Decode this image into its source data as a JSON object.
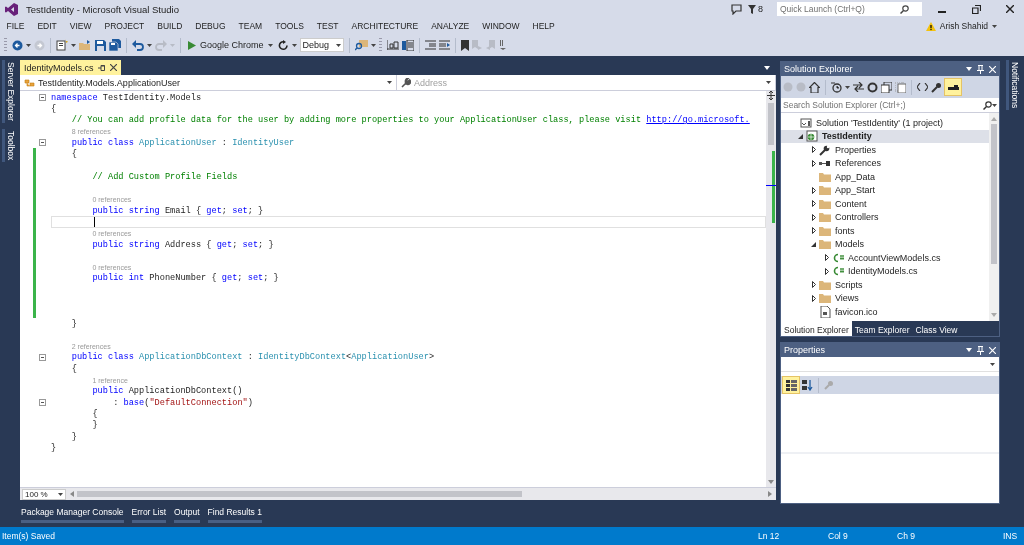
{
  "window": {
    "title": "TestIdentity - Microsoft Visual Studio",
    "notification_count": "8",
    "quick_launch": {
      "placeholder": "Quick Launch (Ctrl+Q)"
    }
  },
  "menu": [
    "FILE",
    "EDIT",
    "VIEW",
    "PROJECT",
    "BUILD",
    "DEBUG",
    "TEAM",
    "TOOLS",
    "TEST",
    "ARCHITECTURE",
    "ANALYZE",
    "WINDOW",
    "HELP"
  ],
  "account": {
    "name": "Arish Shahid"
  },
  "toolbar": {
    "start_target": "Google Chrome",
    "configuration": "Debug"
  },
  "left_side_tabs": [
    "Server Explorer",
    "Toolbox"
  ],
  "right_side_tabs": [
    "Notifications"
  ],
  "editor": {
    "tabs": [
      {
        "label": "IdentityModels.cs",
        "selected": true
      }
    ],
    "type_dropdown": "TestIdentity.Models.ApplicationUser",
    "member_dropdown": "Address",
    "lines": [
      {
        "collapsible": true,
        "changed": false,
        "current": false,
        "tokens": [
          {
            "kind": "keyword",
            "text": "namespace"
          },
          {
            "kind": "plain",
            "text": " TestIdentity.Models"
          }
        ]
      },
      {
        "collapsible": false,
        "changed": false,
        "current": false,
        "tokens": [
          {
            "kind": "plain",
            "text": "{"
          }
        ]
      },
      {
        "collapsible": false,
        "changed": false,
        "current": false,
        "tokens": [
          {
            "kind": "comment",
            "text": "    // You can add profile data for the user by adding more properties to your ApplicationUser class, please visit "
          },
          {
            "kind": "link",
            "text": "http://go.microsoft."
          }
        ]
      },
      {
        "collapsible": false,
        "changed": false,
        "current": false,
        "tokens": [
          {
            "kind": "codelens",
            "text": "    8 references"
          }
        ]
      },
      {
        "collapsible": true,
        "changed": false,
        "current": false,
        "tokens": [
          {
            "kind": "keyword",
            "text": "    public class "
          },
          {
            "kind": "type",
            "text": "ApplicationUser"
          },
          {
            "kind": "plain",
            "text": " : "
          },
          {
            "kind": "type",
            "text": "IdentityUser"
          }
        ]
      },
      {
        "collapsible": false,
        "changed": true,
        "current": false,
        "tokens": [
          {
            "kind": "plain",
            "text": "    {"
          }
        ]
      },
      {
        "collapsible": false,
        "changed": true,
        "current": false
      },
      {
        "collapsible": false,
        "changed": true,
        "current": false,
        "tokens": [
          {
            "kind": "comment",
            "text": "        // Add Custom Profile Fields"
          }
        ]
      },
      {
        "collapsible": false,
        "changed": true,
        "current": false
      },
      {
        "collapsible": false,
        "changed": true,
        "current": false,
        "tokens": [
          {
            "kind": "codelens",
            "text": "        0 references"
          }
        ]
      },
      {
        "collapsible": false,
        "changed": true,
        "current": false,
        "tokens": [
          {
            "kind": "keyword",
            "text": "        public string"
          },
          {
            "kind": "plain",
            "text": " Email { "
          },
          {
            "kind": "keyword",
            "text": "get"
          },
          {
            "kind": "plain",
            "text": "; "
          },
          {
            "kind": "keyword",
            "text": "set"
          },
          {
            "kind": "plain",
            "text": "; }"
          }
        ]
      },
      {
        "collapsible": false,
        "changed": true,
        "current": true
      },
      {
        "collapsible": false,
        "changed": true,
        "current": false,
        "tokens": [
          {
            "kind": "codelens",
            "text": "        0 references"
          }
        ]
      },
      {
        "collapsible": false,
        "changed": true,
        "current": false,
        "tokens": [
          {
            "kind": "keyword",
            "text": "        public string"
          },
          {
            "kind": "plain",
            "text": " Address { "
          },
          {
            "kind": "keyword",
            "text": "get"
          },
          {
            "kind": "plain",
            "text": "; "
          },
          {
            "kind": "keyword",
            "text": "set"
          },
          {
            "kind": "plain",
            "text": "; }"
          }
        ]
      },
      {
        "collapsible": false,
        "changed": true,
        "current": false
      },
      {
        "collapsible": false,
        "changed": true,
        "current": false,
        "tokens": [
          {
            "kind": "codelens",
            "text": "        0 references"
          }
        ]
      },
      {
        "collapsible": false,
        "changed": true,
        "current": false,
        "tokens": [
          {
            "kind": "keyword",
            "text": "        public int"
          },
          {
            "kind": "plain",
            "text": " PhoneNumber { "
          },
          {
            "kind": "keyword",
            "text": "get"
          },
          {
            "kind": "plain",
            "text": "; "
          },
          {
            "kind": "keyword",
            "text": "set"
          },
          {
            "kind": "plain",
            "text": "; }"
          }
        ]
      },
      {
        "collapsible": false,
        "changed": true,
        "current": false
      },
      {
        "collapsible": false,
        "changed": true,
        "current": false
      },
      {
        "collapsible": false,
        "changed": true,
        "current": false
      },
      {
        "collapsible": false,
        "changed": false,
        "current": false,
        "tokens": [
          {
            "kind": "plain",
            "text": "    }"
          }
        ]
      },
      {
        "collapsible": false,
        "changed": false,
        "current": false
      },
      {
        "collapsible": false,
        "changed": false,
        "current": false,
        "tokens": [
          {
            "kind": "codelens",
            "text": "    2 references"
          }
        ]
      },
      {
        "collapsible": true,
        "changed": false,
        "current": false,
        "tokens": [
          {
            "kind": "keyword",
            "text": "    public class "
          },
          {
            "kind": "type",
            "text": "ApplicationDbContext"
          },
          {
            "kind": "plain",
            "text": " : "
          },
          {
            "kind": "type",
            "text": "IdentityDbContext"
          },
          {
            "kind": "plain",
            "text": "<"
          },
          {
            "kind": "type",
            "text": "ApplicationUser"
          },
          {
            "kind": "plain",
            "text": ">"
          }
        ]
      },
      {
        "collapsible": false,
        "changed": false,
        "current": false,
        "tokens": [
          {
            "kind": "plain",
            "text": "    {"
          }
        ]
      },
      {
        "collapsible": false,
        "changed": false,
        "current": false,
        "tokens": [
          {
            "kind": "codelens",
            "text": "        1 reference"
          }
        ]
      },
      {
        "collapsible": false,
        "changed": false,
        "current": false,
        "tokens": [
          {
            "kind": "keyword",
            "text": "        public"
          },
          {
            "kind": "plain",
            "text": " ApplicationDbContext()"
          }
        ]
      },
      {
        "collapsible": true,
        "changed": false,
        "current": false,
        "tokens": [
          {
            "kind": "plain",
            "text": "            : "
          },
          {
            "kind": "keyword",
            "text": "base"
          },
          {
            "kind": "plain",
            "text": "("
          },
          {
            "kind": "string",
            "text": "\"DefaultConnection\""
          },
          {
            "kind": "plain",
            "text": ")"
          }
        ]
      },
      {
        "collapsible": false,
        "changed": false,
        "current": false,
        "tokens": [
          {
            "kind": "plain",
            "text": "        {"
          }
        ]
      },
      {
        "collapsible": false,
        "changed": false,
        "current": false,
        "tokens": [
          {
            "kind": "plain",
            "text": "        }"
          }
        ]
      },
      {
        "collapsible": false,
        "changed": false,
        "current": false,
        "tokens": [
          {
            "kind": "plain",
            "text": "    }"
          }
        ]
      },
      {
        "collapsible": false,
        "changed": false,
        "current": false,
        "tokens": [
          {
            "kind": "plain",
            "text": "}"
          }
        ]
      }
    ],
    "zoom": "100 %"
  },
  "tool_tabs": [
    "Package Manager Console",
    "Error List",
    "Output",
    "Find Results 1"
  ],
  "solution_explorer": {
    "title": "Solution Explorer",
    "search": {
      "placeholder": "Search Solution Explorer (Ctrl+;)"
    },
    "tree": [
      {
        "label": "Solution 'TestIdentity' (1 project)",
        "kind": "solution",
        "selected": false,
        "children": [
          {
            "label": "TestIdentity",
            "kind": "project",
            "selected": true,
            "expanded": true,
            "children": [
              {
                "label": "Properties",
                "kind": "properties",
                "selected": false,
                "expanded": false
              },
              {
                "label": "References",
                "kind": "references",
                "selected": false,
                "expanded": false
              },
              {
                "label": "App_Data",
                "kind": "folder",
                "selected": false
              },
              {
                "label": "App_Start",
                "kind": "folder",
                "selected": false,
                "expanded": false
              },
              {
                "label": "Content",
                "kind": "folder",
                "selected": false,
                "expanded": false
              },
              {
                "label": "Controllers",
                "kind": "folder",
                "selected": false,
                "expanded": false
              },
              {
                "label": "fonts",
                "kind": "folder",
                "selected": false,
                "expanded": false
              },
              {
                "label": "Models",
                "kind": "folder",
                "selected": false,
                "expanded": true,
                "children": [
                  {
                    "label": "AccountViewModels.cs",
                    "kind": "csfile",
                    "selected": false,
                    "expanded": false
                  },
                  {
                    "label": "IdentityModels.cs",
                    "kind": "csfile",
                    "selected": false,
                    "expanded": false
                  }
                ]
              },
              {
                "label": "Scripts",
                "kind": "folder",
                "selected": false,
                "expanded": false
              },
              {
                "label": "Views",
                "kind": "folder",
                "selected": false,
                "expanded": false
              },
              {
                "label": "favicon.ico",
                "kind": "file",
                "selected": false
              }
            ]
          }
        ]
      }
    ],
    "tabs": [
      {
        "label": "Solution Explorer",
        "selected": true
      },
      {
        "label": "Team Explorer",
        "selected": false
      },
      {
        "label": "Class View",
        "selected": false
      }
    ]
  },
  "properties": {
    "title": "Properties"
  },
  "status_bar": {
    "message": "Item(s) Saved",
    "line": "Ln 12",
    "column": "Col 9",
    "character": "Ch 9",
    "mode": "INS"
  }
}
